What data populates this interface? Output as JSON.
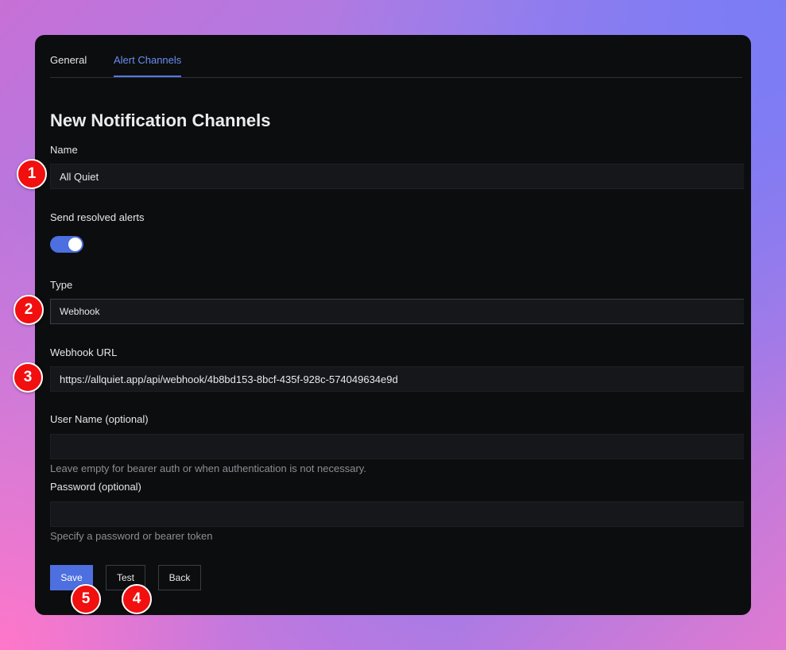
{
  "tabs": [
    {
      "label": "General"
    },
    {
      "label": "Alert Channels"
    }
  ],
  "page_title": "New Notification Channels",
  "form": {
    "name": {
      "label": "Name",
      "value": "All Quiet"
    },
    "send_resolved": {
      "label": "Send resolved alerts",
      "enabled": true
    },
    "type": {
      "label": "Type",
      "value": "Webhook"
    },
    "webhook_url": {
      "label": "Webhook URL",
      "value": "https://allquiet.app/api/webhook/4b8bd153-8bcf-435f-928c-574049634e9d"
    },
    "user_name": {
      "label": "User Name (optional)",
      "value": "",
      "helper": "Leave empty for bearer auth or when authentication is not necessary."
    },
    "password": {
      "label": "Password (optional)",
      "value": "",
      "helper": "Specify a password or bearer token"
    }
  },
  "buttons": {
    "save": "Save",
    "test": "Test",
    "back": "Back"
  },
  "badges": [
    "1",
    "2",
    "3",
    "4",
    "5"
  ],
  "colors": {
    "accent": "#4d6fe0",
    "badge": "#f10f0f",
    "panel_bg": "#0c0d0f"
  }
}
